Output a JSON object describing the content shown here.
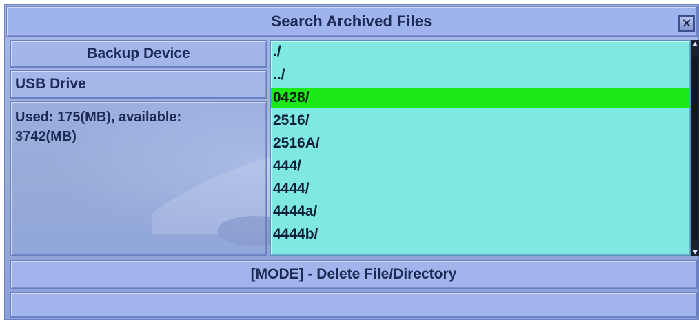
{
  "dialog": {
    "title": "Search Archived Files",
    "close_icon": "close-icon"
  },
  "backup_device": {
    "header": "Backup Device",
    "device_name": "USB Drive",
    "usage_text": "Used: 175(MB), available: 3742(MB)"
  },
  "file_list": {
    "items": [
      "./",
      "../",
      "0428/",
      "2516/",
      "2516A/",
      "444/",
      "4444/",
      "4444a/",
      "4444b/"
    ],
    "selected_index": 2,
    "selected_color": "#1de81a",
    "background_color": "#7fe8e0"
  },
  "footer": {
    "hint": "[MODE] - Delete File/Directory",
    "status": ""
  },
  "colors": {
    "panel": "#a1b4eb",
    "text": "#1c2a55"
  }
}
